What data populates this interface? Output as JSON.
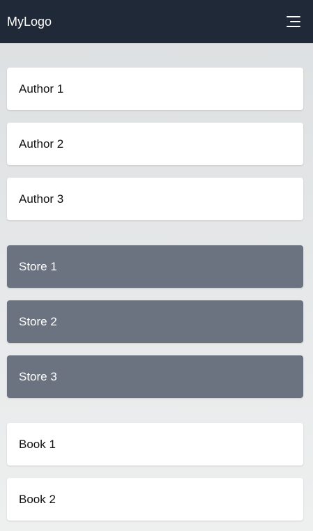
{
  "header": {
    "logo": "MyLogo",
    "menu_icon": "hamburger-menu-icon"
  },
  "authors": [
    {
      "label": "Author 1"
    },
    {
      "label": "Author 2"
    },
    {
      "label": "Author 3"
    }
  ],
  "stores": [
    {
      "label": "Store 1"
    },
    {
      "label": "Store 2"
    },
    {
      "label": "Store 3"
    }
  ],
  "books": [
    {
      "label": "Book 1"
    },
    {
      "label": "Book 2"
    }
  ],
  "colors": {
    "navbar": "#1f2937",
    "store_card": "#6b7280",
    "card": "#ffffff"
  }
}
